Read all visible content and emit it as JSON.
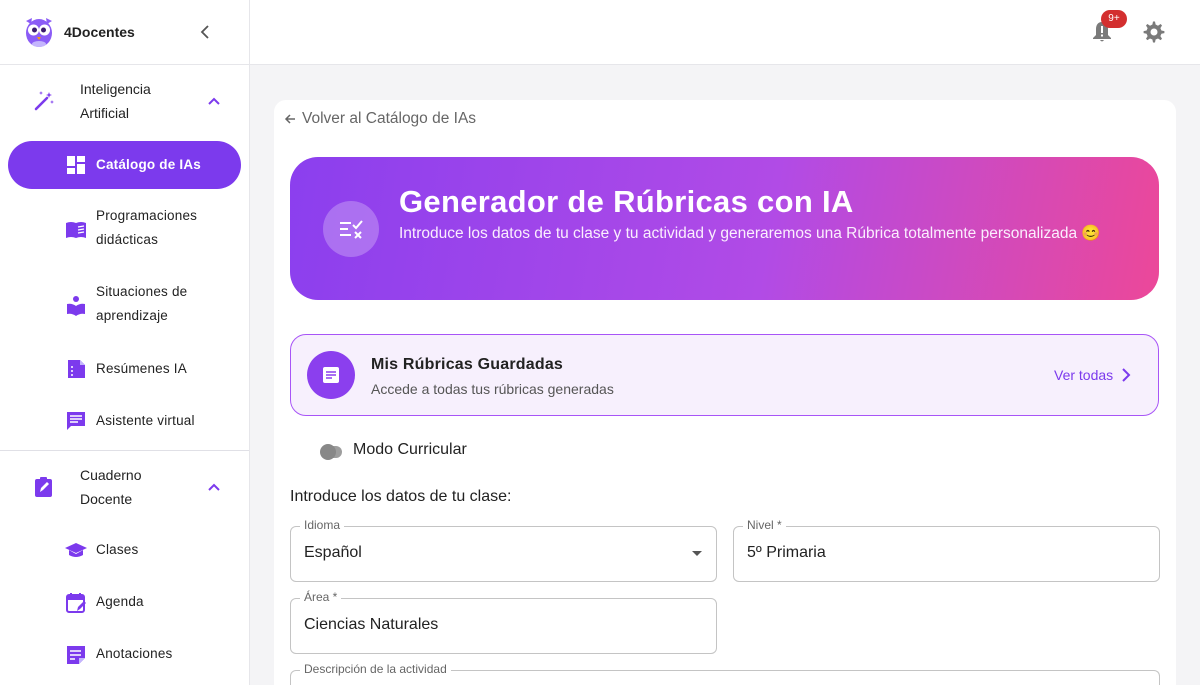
{
  "brand": {
    "name": "4Docentes"
  },
  "sidebar": {
    "groups": [
      {
        "label": "Inteligencia Artificial",
        "items": [
          {
            "label": "Catálogo de IAs",
            "icon": "dashboard-icon",
            "active": true
          },
          {
            "label": "Programaciones didácticas",
            "icon": "book-open-icon"
          },
          {
            "label": "Situaciones de aprendizaje",
            "icon": "reading-person-icon"
          },
          {
            "label": "Resúmenes IA",
            "icon": "summary-doc-icon"
          },
          {
            "label": "Asistente virtual",
            "icon": "chat-icon"
          }
        ]
      },
      {
        "label": "Cuaderno Docente",
        "items": [
          {
            "label": "Clases",
            "icon": "graduation-cap-icon"
          },
          {
            "label": "Agenda",
            "icon": "calendar-edit-icon"
          },
          {
            "label": "Anotaciones",
            "icon": "notes-icon"
          }
        ]
      }
    ]
  },
  "topbar": {
    "notification_badge": "9+"
  },
  "main": {
    "back_link": "Volver al Catálogo de IAs",
    "hero": {
      "title": "Generador de Rúbricas con IA",
      "subtitle": "Introduce los datos de tu clase y tu actividad y generaremos una Rúbrica totalmente personalizada 😊"
    },
    "saved": {
      "title": "Mis Rúbricas Guardadas",
      "subtitle": "Accede a todas tus rúbricas generadas",
      "link": "Ver todas"
    },
    "toggle_label": "Modo Curricular",
    "section_label": "Introduce los datos de tu clase:",
    "fields": {
      "idioma": {
        "label": "Idioma",
        "value": "Español"
      },
      "nivel": {
        "label": "Nivel *",
        "value": "5º Primaria"
      },
      "area": {
        "label": "Área *",
        "value": "Ciencias Naturales"
      },
      "descripcion": {
        "label": "Descripción de la actividad",
        "value": ""
      }
    }
  },
  "colors": {
    "accent": "#7c3aed",
    "hero_start": "#8b3fee",
    "hero_end": "#ec4899",
    "badge": "#d32f2f"
  }
}
